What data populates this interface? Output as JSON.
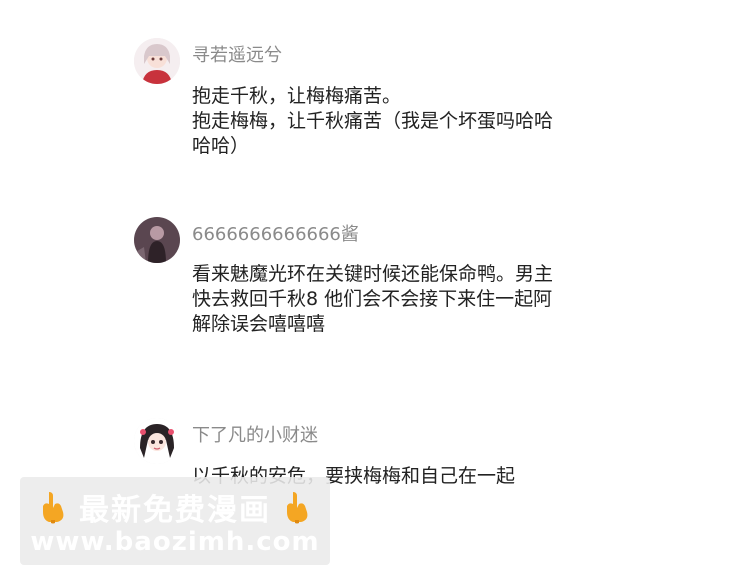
{
  "comments": [
    {
      "username": "寻若遥远兮",
      "lines": [
        "抱走千秋，让梅梅痛苦。",
        "抱走梅梅，让千秋痛苦（我是个坏蛋吗哈哈",
        "哈哈）"
      ]
    },
    {
      "username": "6666666666666酱",
      "lines": [
        "看来魅魔光环在关键时候还能保命鸭。男主",
        "快去救回千秋8 他们会不会接下来住一起阿",
        "解除误会嘻嘻嘻"
      ]
    },
    {
      "username": "下了凡的小财迷",
      "lines": [
        "以千秋的安危，要挟梅梅和自己在一起"
      ]
    }
  ],
  "watermark": {
    "title": "最新免费漫画",
    "url": "www.baozimh.com",
    "icon": "pointing-down-hand-icon"
  },
  "colors": {
    "username": "#8a8a8a",
    "body_text": "#222222",
    "hand": "#f4a623"
  }
}
